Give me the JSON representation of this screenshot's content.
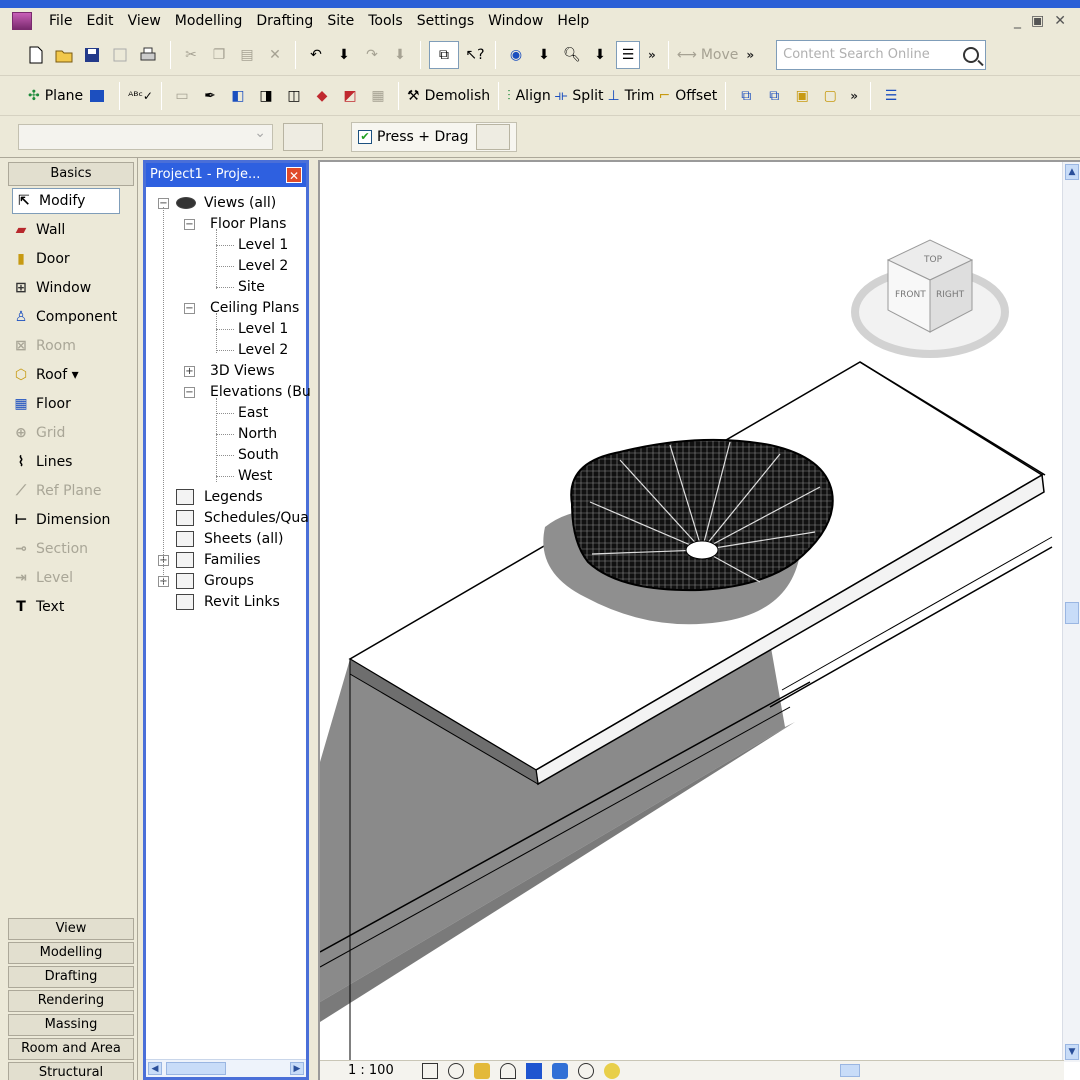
{
  "menu": [
    "File",
    "Edit",
    "View",
    "Modelling",
    "Drafting",
    "Site",
    "Tools",
    "Settings",
    "Window",
    "Help"
  ],
  "toolbar": {
    "move": "Move",
    "search_placeholder": "Content Search Online",
    "plane": "Plane",
    "demolish": "Demolish",
    "align": "Align",
    "split": "Split",
    "trim": "Trim",
    "offset": "Offset",
    "press_drag": "Press + Drag"
  },
  "design_bar": {
    "header": "Basics",
    "tools": [
      {
        "label": "Modify",
        "icon": "arrow-cursor-icon",
        "enabled": true
      },
      {
        "label": "Wall",
        "icon": "wall-icon",
        "enabled": true
      },
      {
        "label": "Door",
        "icon": "door-icon",
        "enabled": true
      },
      {
        "label": "Window",
        "icon": "window-icon",
        "enabled": true
      },
      {
        "label": "Component",
        "icon": "component-icon",
        "enabled": true
      },
      {
        "label": "Room",
        "icon": "room-icon",
        "enabled": false
      },
      {
        "label": "Roof ▾",
        "icon": "roof-icon",
        "enabled": true
      },
      {
        "label": "Floor",
        "icon": "floor-icon",
        "enabled": true
      },
      {
        "label": "Grid",
        "icon": "grid-icon",
        "enabled": false
      },
      {
        "label": "Lines",
        "icon": "lines-icon",
        "enabled": true
      },
      {
        "label": "Ref Plane",
        "icon": "ref-plane-icon",
        "enabled": false
      },
      {
        "label": "Dimension",
        "icon": "dimension-icon",
        "enabled": true
      },
      {
        "label": "Section",
        "icon": "section-icon",
        "enabled": false
      },
      {
        "label": "Level",
        "icon": "level-icon",
        "enabled": false
      },
      {
        "label": "Text",
        "icon": "text-icon",
        "enabled": true
      }
    ],
    "tabs": [
      "View",
      "Modelling",
      "Drafting",
      "Rendering",
      "Massing",
      "Room and Area",
      "Structural"
    ]
  },
  "project_browser": {
    "title": "Project1 - Proje...",
    "nodes": [
      {
        "label": "Views (all)",
        "level": 0
      },
      {
        "label": "Floor Plans",
        "level": 1
      },
      {
        "label": "Level 1",
        "level": 2
      },
      {
        "label": "Level 2",
        "level": 2
      },
      {
        "label": "Site",
        "level": 2
      },
      {
        "label": "Ceiling Plans",
        "level": 1
      },
      {
        "label": "Level 1",
        "level": 2
      },
      {
        "label": "Level 2",
        "level": 2
      },
      {
        "label": "3D Views",
        "level": 1
      },
      {
        "label": "Elevations (Bu",
        "level": 1
      },
      {
        "label": "East",
        "level": 2
      },
      {
        "label": "North",
        "level": 2
      },
      {
        "label": "South",
        "level": 2
      },
      {
        "label": "West",
        "level": 2
      },
      {
        "label": "Legends",
        "level": 0
      },
      {
        "label": "Schedules/Qua",
        "level": 0
      },
      {
        "label": "Sheets (all)",
        "level": 0
      },
      {
        "label": "Families",
        "level": 0
      },
      {
        "label": "Groups",
        "level": 0
      },
      {
        "label": "Revit Links",
        "level": 0
      }
    ]
  },
  "view": {
    "scale": "1 : 100",
    "viewcube": {
      "front": "FRONT",
      "right": "RIGHT",
      "top": "TOP"
    }
  }
}
